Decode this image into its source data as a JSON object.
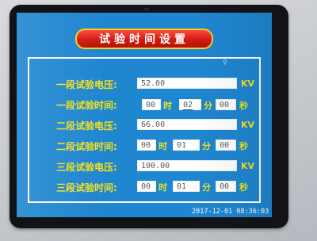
{
  "title": "试验时间设置",
  "rows": [
    {
      "label": "一段试验电压:",
      "value": "52.00",
      "unit": "KV"
    },
    {
      "label": "一段试验时间:",
      "h": "00",
      "m": "02",
      "s": "00"
    },
    {
      "label": "二段试验电压:",
      "value": "66.00",
      "unit": "KV"
    },
    {
      "label": "二段试验时间:",
      "h": "00",
      "m": "01",
      "s": "00"
    },
    {
      "label": "三段试验电压:",
      "value": "100.00",
      "unit": "KV"
    },
    {
      "label": "三段试验时间:",
      "h": "00",
      "m": "01",
      "s": "00"
    }
  ],
  "units": {
    "hour": "时",
    "minute": "分",
    "second": "秒"
  },
  "datetime": "2017-12-01 08:36:03",
  "colors": {
    "screen_bg": "#1f86d0",
    "label": "#f4e21c",
    "title_bg": "#d01c12",
    "title_border": "#f4d11a"
  }
}
